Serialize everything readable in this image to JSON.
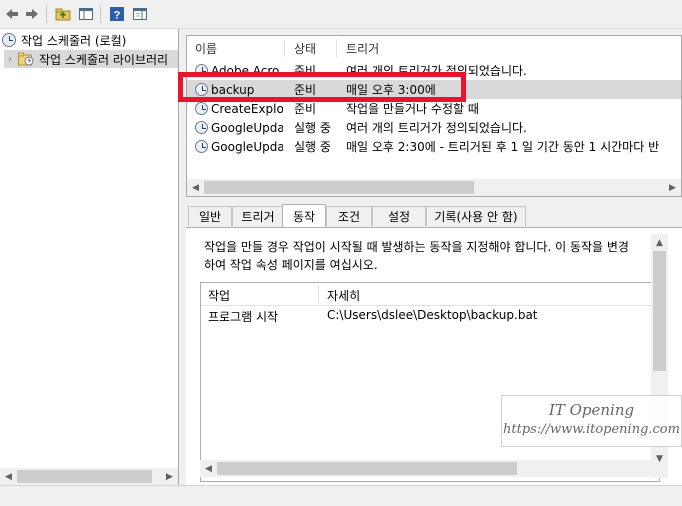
{
  "toolbar": {
    "buttons": [
      {
        "icon": "back-arrow-icon"
      },
      {
        "icon": "forward-arrow-icon"
      },
      {
        "icon": "folder-up-icon"
      },
      {
        "icon": "show-hide-pane-icon"
      },
      {
        "icon": "help-icon"
      },
      {
        "icon": "action-pane-icon"
      }
    ]
  },
  "tree": {
    "root_label": "작업 스케줄러 (로컬)",
    "child_label": "작업 스케줄러 라이브러리"
  },
  "tasklist": {
    "columns": [
      "이름",
      "상태",
      "트리거"
    ],
    "rows": [
      {
        "name": "Adobe Acro...",
        "status": "준비",
        "trigger": "여러 개의 트리거가 정의되었습니다."
      },
      {
        "name": "backup",
        "status": "준비",
        "trigger": "매일 오후 3:00에",
        "selected": true
      },
      {
        "name": "CreateExplor...",
        "status": "준비",
        "trigger": "작업을 만들거나 수정할 때"
      },
      {
        "name": "GoogleUpda...",
        "status": "실행 중",
        "trigger": "여러 개의 트리거가 정의되었습니다."
      },
      {
        "name": "GoogleUpda...",
        "status": "실행 중",
        "trigger": "매일 오후 2:30에 - 트리거된 후 1 일 기간 동안 1 시간마다 반"
      }
    ]
  },
  "detail": {
    "tabs": [
      "일반",
      "트리거",
      "동작",
      "조건",
      "설정",
      "기록(사용 안 함)"
    ],
    "active_tab": "동작",
    "description_line1": "작업을 만들 경우 작업이 시작될 때 발생하는 동작을 지정해야 합니다. 이 동작을 변경",
    "description_line2": "하여 작업 속성 페이지를 여십시오.",
    "actions_columns": [
      "작업",
      "자세히"
    ],
    "actions_rows": [
      {
        "action": "프로그램 시작",
        "details": "C:\\Users\\dslee\\Desktop\\backup.bat"
      }
    ]
  },
  "watermark": {
    "line1": "IT Opening",
    "line2": "https://www.itopening.com"
  },
  "colors": {
    "highlight": "#e8152a",
    "selected_row": "#d9d9d9"
  }
}
